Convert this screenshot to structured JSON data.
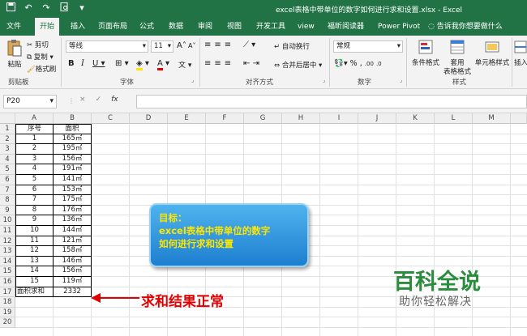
{
  "title": "excel表格中带单位的数字如何进行求和设置.xlsx  -  Excel",
  "qat_icons": [
    "save-icon",
    "undo-icon",
    "redo-icon",
    "print-preview-icon",
    "customize-qat-icon"
  ],
  "menu": [
    "文件",
    "开始",
    "插入",
    "页面布局",
    "公式",
    "数据",
    "审阅",
    "视图",
    "开发工具",
    "view",
    "福昕阅读器",
    "Power Pivot"
  ],
  "tell_me": "告诉我你想要做什么",
  "ribbon": {
    "paste": "粘贴",
    "cut": "剪切",
    "copy": "复制",
    "format_painter": "格式刷",
    "clipboard": "剪贴板",
    "font_name": "等线",
    "font_size": "11",
    "grow": "A",
    "shrink": "A",
    "bold": "B",
    "italic": "I",
    "underline": "U",
    "font_color": "A",
    "wen": "文",
    "font": "字体",
    "wrap": "自动换行",
    "merge": "合并后居中",
    "alignment": "对齐方式",
    "number_format": "常规",
    "percent": "%",
    "comma": ",",
    "dec_inc": ".00",
    "dec_dec": ".0",
    "number": "数字",
    "cond_format": "条件格式",
    "table_format": "套用",
    "table_format2": "表格格式",
    "cell_style": "单元格样式",
    "styles": "样式",
    "insert": "插入"
  },
  "formula_bar": {
    "name_box": "P20",
    "cancel": "×",
    "enter": "✓",
    "fx": "fx"
  },
  "columns": [
    "A",
    "B",
    "C",
    "D",
    "E",
    "F",
    "G",
    "H",
    "I",
    "J",
    "K",
    "L",
    "M"
  ],
  "rows": [
    "1",
    "2",
    "3",
    "4",
    "5",
    "6",
    "7",
    "8",
    "9",
    "10",
    "11",
    "12",
    "13",
    "14",
    "15",
    "16",
    "17",
    "18",
    "19",
    "20"
  ],
  "table": {
    "header": [
      "序号",
      "面积"
    ],
    "rows": [
      [
        "1",
        "165㎡"
      ],
      [
        "2",
        "195㎡"
      ],
      [
        "3",
        "156㎡"
      ],
      [
        "4",
        "191㎡"
      ],
      [
        "5",
        "141㎡"
      ],
      [
        "6",
        "153㎡"
      ],
      [
        "7",
        "175㎡"
      ],
      [
        "8",
        "176㎡"
      ],
      [
        "9",
        "136㎡"
      ],
      [
        "10",
        "144㎡"
      ],
      [
        "11",
        "121㎡"
      ],
      [
        "12",
        "158㎡"
      ],
      [
        "13",
        "146㎡"
      ],
      [
        "14",
        "156㎡"
      ],
      [
        "15",
        "119㎡"
      ]
    ],
    "total_label": "面积求和",
    "total_value": "2332"
  },
  "note": {
    "line1": "目标：",
    "line2": "excel表格中带单位的数字",
    "line3": "如何进行求和设置"
  },
  "result_label": "求和结果正常",
  "brand": "百科全说",
  "brand_sub": "助你轻松解决",
  "colors": {
    "excel_green": "#217346",
    "note_text": "#ffe600",
    "result_red": "#e00000",
    "brand_green": "#2a8d3d"
  }
}
